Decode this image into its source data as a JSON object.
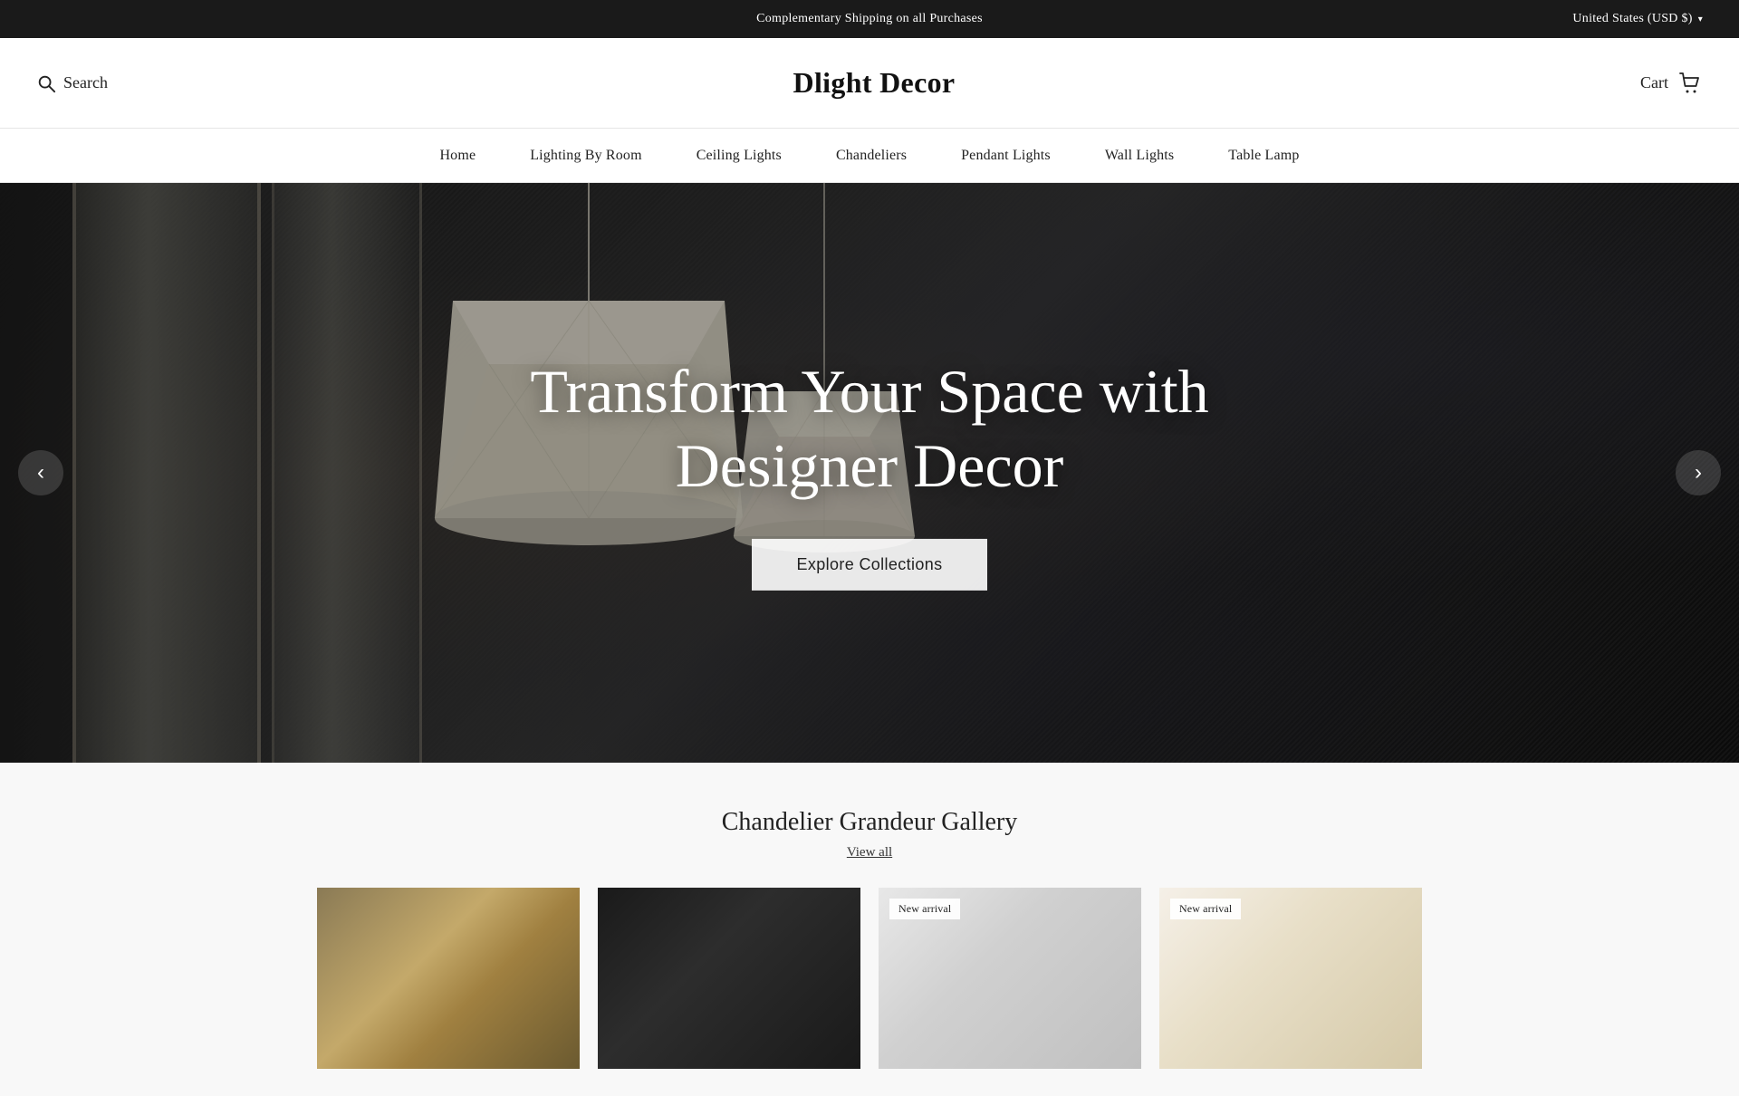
{
  "topBanner": {
    "message": "Complementary Shipping on all Purchases",
    "region": "United States (USD $)",
    "chevron": "▾"
  },
  "header": {
    "searchLabel": "Search",
    "logo": "Dlight Decor",
    "cartLabel": "Cart"
  },
  "nav": {
    "items": [
      {
        "id": "home",
        "label": "Home"
      },
      {
        "id": "lighting-by-room",
        "label": "Lighting By Room"
      },
      {
        "id": "ceiling-lights",
        "label": "Ceiling Lights"
      },
      {
        "id": "chandeliers",
        "label": "Chandeliers"
      },
      {
        "id": "pendant-lights",
        "label": "Pendant Lights"
      },
      {
        "id": "wall-lights",
        "label": "Wall Lights"
      },
      {
        "id": "table-lamp",
        "label": "Table Lamp"
      }
    ]
  },
  "hero": {
    "title": "Transform Your Space with Designer Decor",
    "cta": "Explore Collections",
    "prevArrow": "‹",
    "nextArrow": "›"
  },
  "gallerySection": {
    "title": "Chandelier Grandeur Gallery",
    "viewAllLabel": "View all",
    "products": [
      {
        "id": "prod-1",
        "badge": "",
        "hasNewArrival": false
      },
      {
        "id": "prod-2",
        "badge": "",
        "hasNewArrival": false
      },
      {
        "id": "prod-3",
        "badge": "New arrival",
        "hasNewArrival": true
      },
      {
        "id": "prod-4",
        "badge": "New arrival",
        "hasNewArrival": true
      }
    ]
  }
}
